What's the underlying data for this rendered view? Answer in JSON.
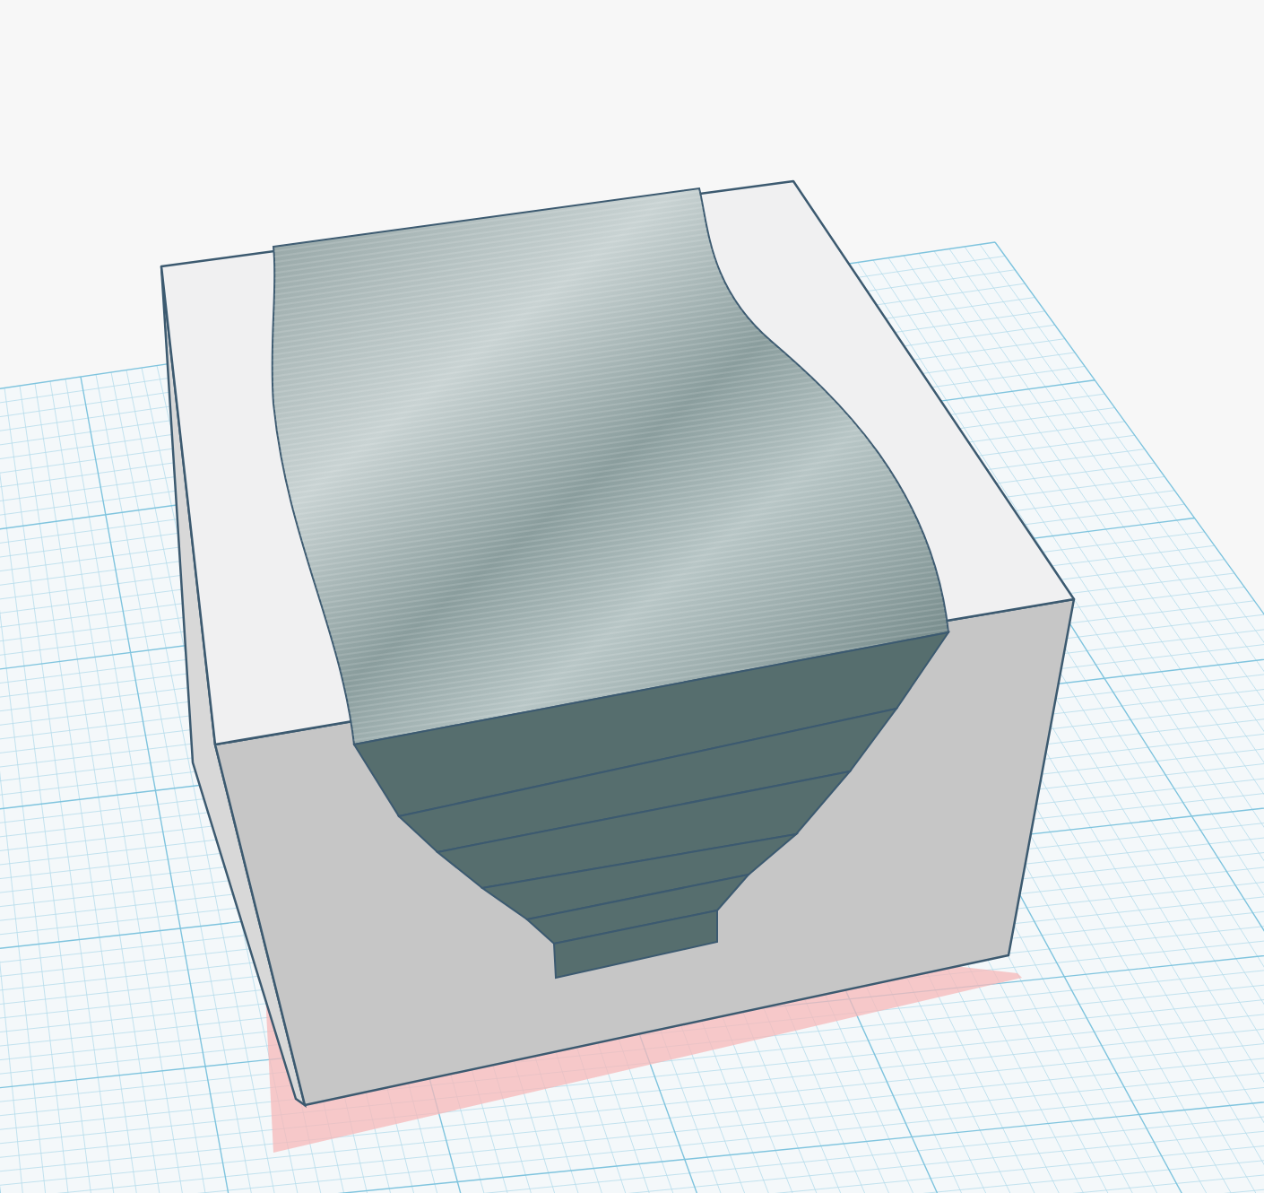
{
  "scene": {
    "grid": true,
    "footprint": true,
    "shapes": [
      {
        "kind": "box"
      },
      {
        "kind": "wave"
      }
    ]
  }
}
